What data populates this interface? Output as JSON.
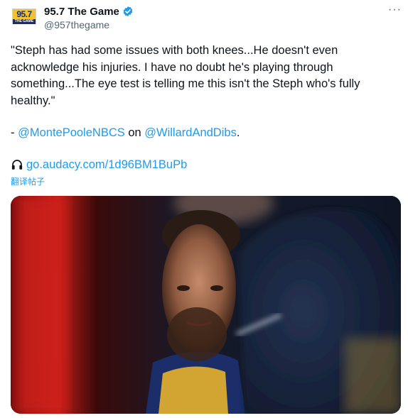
{
  "account": {
    "display_name": "95.7 The Game",
    "handle": "@957thegame",
    "avatar_text": "95.7",
    "avatar_subtext": "THE GAME"
  },
  "tweet": {
    "quote": "\"Steph has had some issues with both knees...He doesn't even acknowledge his injuries. I have no doubt he's playing through something...The eye test is telling me this isn't the Steph who's fully healthy.\"",
    "credit_prefix": "- ",
    "credit_author": "@MontePooleNBCS",
    "credit_on": " on ",
    "credit_show": "@WillardAndDibs",
    "credit_suffix": ".",
    "link": "go.audacy.com/1d96BM1BuPb",
    "translate_label": "翻译帖子"
  },
  "icons": {
    "verified": "verified-badge-icon",
    "more": "more-options-icon",
    "link": "headphones-icon"
  },
  "colors": {
    "link": "#1d9bf0",
    "verified": "#1d9bf0",
    "secondary_text": "#536471"
  }
}
